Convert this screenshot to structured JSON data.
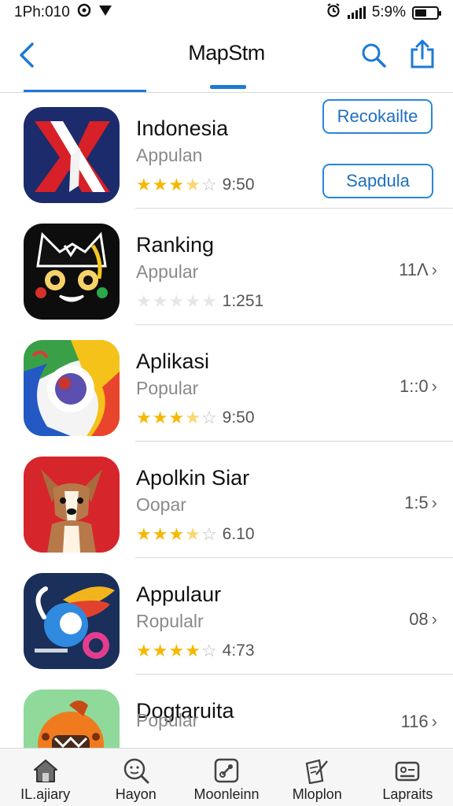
{
  "status_bar": {
    "time": "1Ph:010",
    "battery": "5:9%"
  },
  "nav": {
    "title": "MapStm"
  },
  "apps": [
    {
      "name": "Indonesia",
      "subtitle": "Appulan",
      "rating_text": "9:50",
      "stars": 3.5,
      "icon": "red-white-x-logo-icon"
    },
    {
      "name": "Ranking",
      "subtitle": "Appular",
      "rating_text": "1:251",
      "stars": 0,
      "meta": "11Λ",
      "icon": "black-cat-mascot-icon"
    },
    {
      "name": "Aplikasi",
      "subtitle": "Popular",
      "rating_text": "9:50",
      "stars": 3.5,
      "meta": "1::0",
      "icon": "colorful-swirl-logo-icon"
    },
    {
      "name": "Apolkin Siar",
      "subtitle": "Oopar",
      "rating_text": "6.10",
      "stars": 3.5,
      "meta": "1:5",
      "icon": "dog-mascot-icon"
    },
    {
      "name": "Appulaur",
      "subtitle": "Ropulalr",
      "rating_text": "4:73",
      "stars": 4,
      "meta": "08",
      "icon": "colorful-bird-logo-icon"
    },
    {
      "name": "Dogtaruita",
      "subtitle": "Popular",
      "meta": "116",
      "icon": "orange-monster-mascot-icon"
    }
  ],
  "buttons": {
    "recommend": "Recokailte",
    "update": "Sapdula"
  },
  "tabs": [
    {
      "label": "IL.ajiary",
      "icon": "home-icon"
    },
    {
      "label": "Hayon",
      "icon": "search-face-icon"
    },
    {
      "label": "Moonleinn",
      "icon": "compass-icon"
    },
    {
      "label": "Mloplon",
      "icon": "notepad-icon"
    },
    {
      "label": "Lapraits",
      "icon": "card-icon"
    }
  ],
  "colors": {
    "accent": "#1d7ad6",
    "star": "#f5b800",
    "star_empty": "#bdbdbd"
  }
}
